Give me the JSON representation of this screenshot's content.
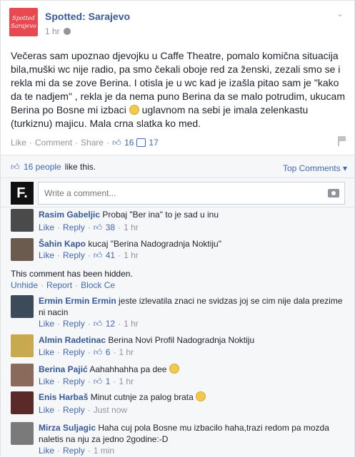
{
  "post": {
    "page_name": "Spotted: Sarajevo",
    "avatar_text": "Spotted Sarajevo",
    "time": "1 hr",
    "body_1": "Večeras sam upoznao djevojku u Caffe Theatre, pomalo komična situacija bila,muški wc nije radio, pa smo čekali oboje red za ženski, zezali smo se i rekla mi da se zove Berina. I otisla je u wc kad je izašla pitao sam je \"kako da te nadjem\" , rekla je da nema puno Berina da se malo potrudim, ukucam Berina po Bosne mi izbaci",
    "body_2": "uglavnom na sebi je imala zelenkastu (turkiznu) majicu. Mala crna slatka ko med.",
    "actions": {
      "like": "Like",
      "comment": "Comment",
      "share": "Share",
      "likes_count": "16",
      "comments_count": "17"
    }
  },
  "ufi": {
    "likes_people": "16 people",
    "likes_suffix": "like this.",
    "sort_label": "Top Comments ▾",
    "composer_placeholder": "Write a comment...",
    "me_avatar_text": "F."
  },
  "labels": {
    "like": "Like",
    "reply": "Reply",
    "dot": "·",
    "unhide": "Unhide",
    "report": "Report",
    "block": "Block Ce"
  },
  "hidden_text": "This comment has been hidden.",
  "comments": [
    {
      "author": "Rasim Gabeljic",
      "text": "Probaj \"Ber ina\" to je sad u inu",
      "likes": "38",
      "time": "1 hr",
      "avatar_color": "#4a4a4a"
    },
    {
      "author": "Šahin Kapo",
      "text": "kucaj \"Berina Nadogradnja Noktiju\"",
      "likes": "41",
      "time": "1 hr",
      "avatar_color": "#6b5a4e"
    },
    {
      "author": "Ermin Ermin Ermin",
      "text": "jeste izlevatila znaci ne svidzas joj se cim nije dala prezime ni nacin",
      "likes": "12",
      "time": "1 hr",
      "avatar_color": "#3c4a5a"
    },
    {
      "author": "Almin Radetinac",
      "text": "Berina Novi Profil Nadogradnja Noktiju",
      "likes": "6",
      "time": "1 hr",
      "avatar_color": "#c9a94f"
    },
    {
      "author": "Berina Pajić",
      "text": "Aahahhahha pa dee",
      "likes": "1",
      "time": "1 hr",
      "avatar_color": "#8a6a5a"
    },
    {
      "author": "Enis Harbaš",
      "text": "Minut cutnje za palog brata",
      "time": "Just now",
      "avatar_color": "#5a2a2a"
    },
    {
      "author": "Mirza Suljagic",
      "text": "Haha cuj pola Bosne mu izbacilo haha,trazi redom pa mozda naletis na nju za jedno 2godine:-D",
      "time": "1 min",
      "avatar_color": "#7a7a7a"
    }
  ]
}
